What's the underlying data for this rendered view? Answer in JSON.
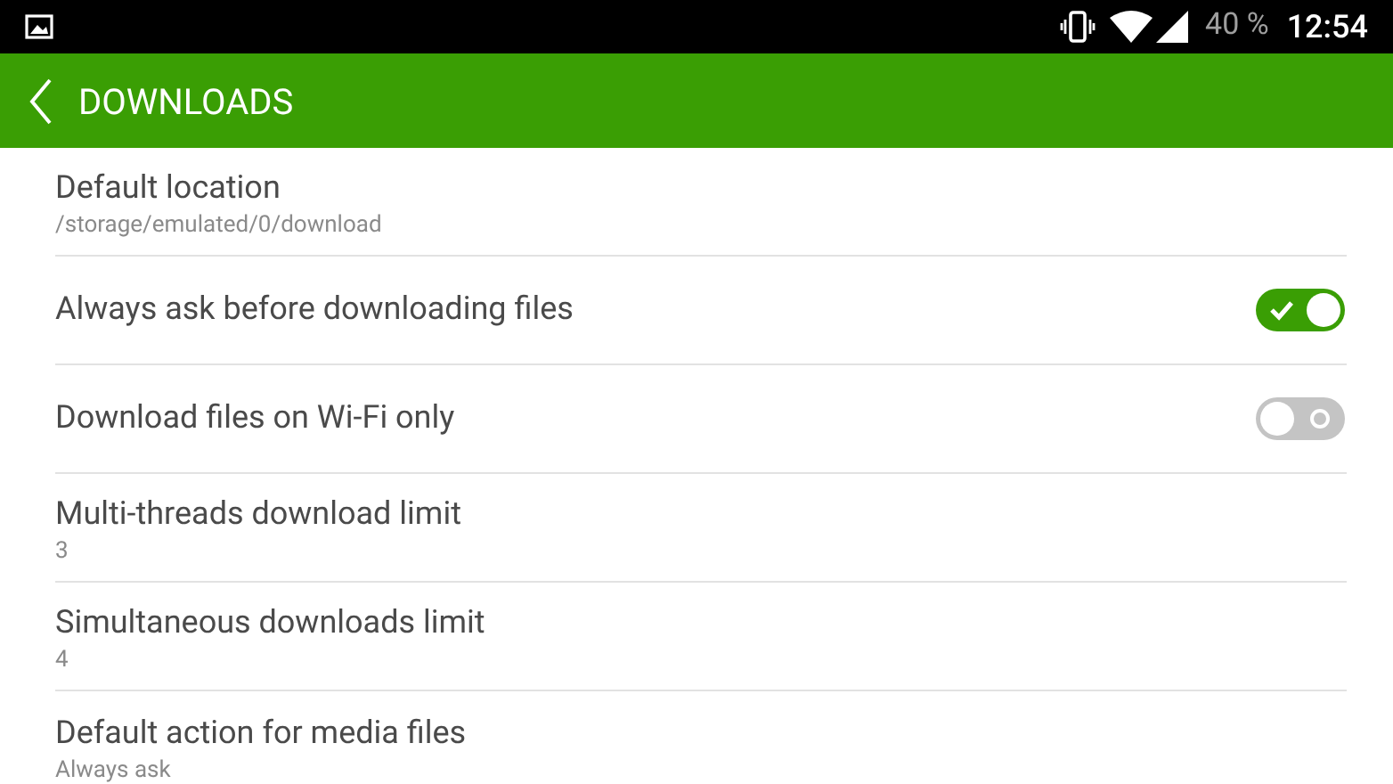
{
  "status_bar": {
    "battery": "40 %",
    "time": "12:54"
  },
  "header": {
    "title": "DOWNLOADS"
  },
  "settings": [
    {
      "kind": "value",
      "title": "Default location",
      "value": "/storage/emulated/0/download"
    },
    {
      "kind": "toggle",
      "title": "Always ask before downloading files",
      "on": true
    },
    {
      "kind": "toggle",
      "title": "Download files on Wi-Fi only",
      "on": false
    },
    {
      "kind": "value",
      "title": "Multi-threads download limit",
      "value": "3"
    },
    {
      "kind": "value",
      "title": "Simultaneous downloads limit",
      "value": "4"
    },
    {
      "kind": "value",
      "title": "Default action for media files",
      "value": "Always ask"
    }
  ]
}
